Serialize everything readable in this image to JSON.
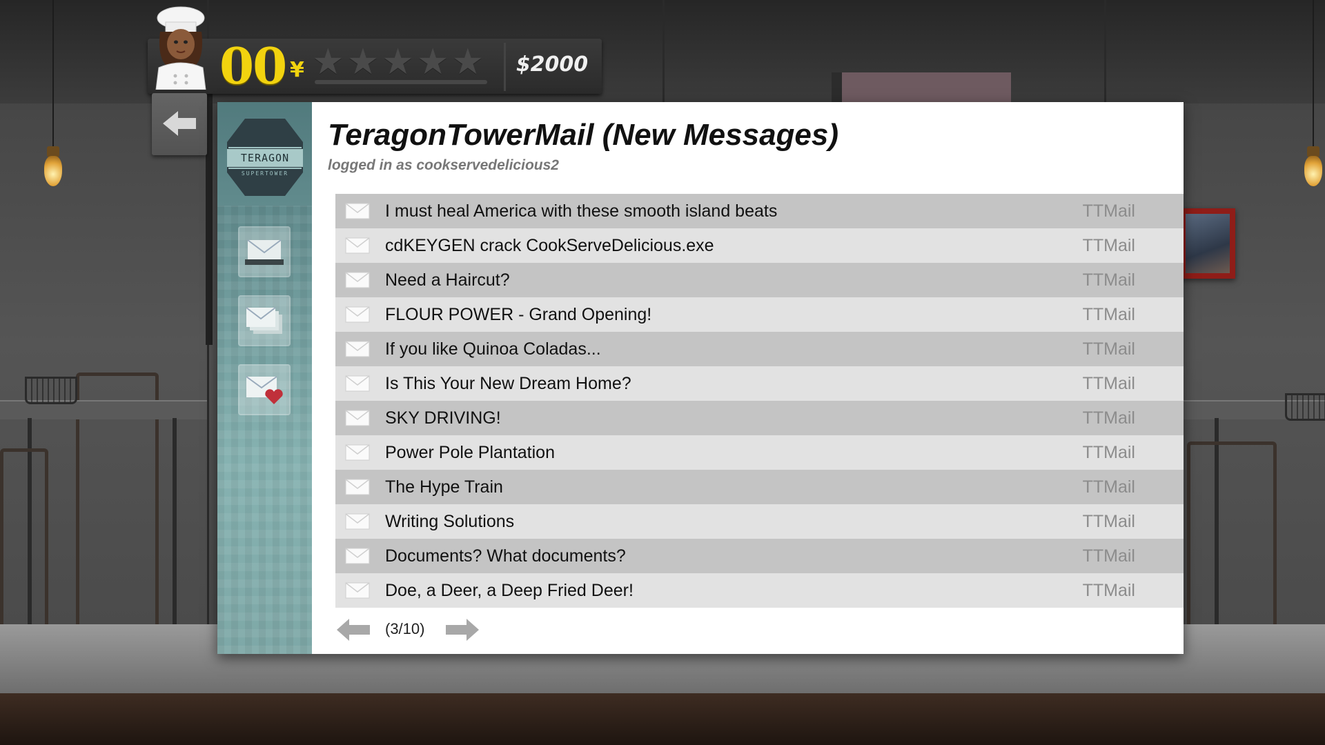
{
  "hud": {
    "combo_count": "00",
    "combo_unit": "¥",
    "star_rating": 0,
    "star_max": 5,
    "money": "$2000"
  },
  "sidebar": {
    "logo_name": "TERAGON",
    "logo_sub": "SUPERTOWER",
    "buttons": [
      "inbox-icon",
      "stacked-mail-icon",
      "heart-mail-icon"
    ]
  },
  "mail": {
    "title": "TeragonTowerMail (New Messages)",
    "subtitle": "logged in as cookservedelicious2",
    "messages": [
      {
        "subject": "I must heal America with these smooth island beats",
        "sender": "TTMail"
      },
      {
        "subject": "cdKEYGEN crack CookServeDelicious.exe",
        "sender": "TTMail"
      },
      {
        "subject": "Need a Haircut?",
        "sender": "TTMail"
      },
      {
        "subject": "FLOUR POWER - Grand Opening!",
        "sender": "TTMail"
      },
      {
        "subject": "If you like Quinoa Coladas...",
        "sender": "TTMail"
      },
      {
        "subject": "Is This Your New Dream Home?",
        "sender": "TTMail"
      },
      {
        "subject": "SKY DRIVING!",
        "sender": "TTMail"
      },
      {
        "subject": "Power Pole Plantation",
        "sender": "TTMail"
      },
      {
        "subject": "The Hype Train",
        "sender": "TTMail"
      },
      {
        "subject": "Writing Solutions",
        "sender": "TTMail"
      },
      {
        "subject": "Documents? What documents?",
        "sender": "TTMail"
      },
      {
        "subject": "Doe, a Deer, a Deep Fried Deer!",
        "sender": "TTMail"
      }
    ],
    "pagination": "(3/10)"
  },
  "colors": {
    "combo_yellow": "#f2d30f",
    "row_dark": "#c4c4c4",
    "row_light": "#e2e2e2",
    "sidebar_teal": "#6f9a9b"
  }
}
